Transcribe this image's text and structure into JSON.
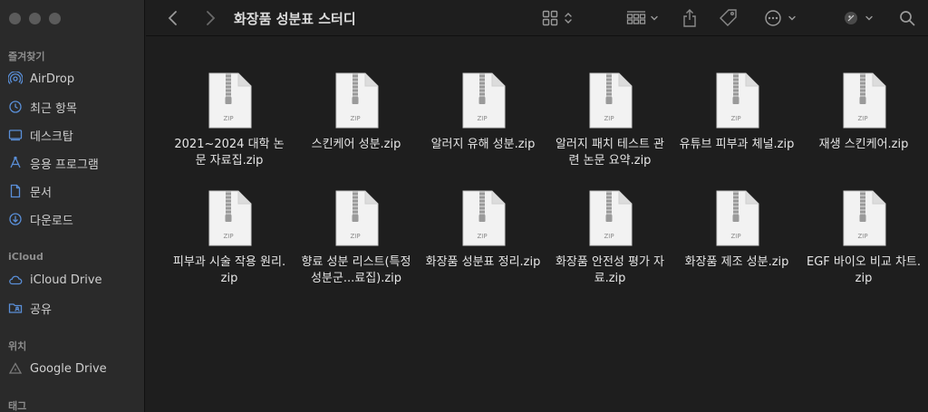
{
  "window": {
    "title": "화장품 성분표 스터디"
  },
  "sidebar": {
    "favorites_title": "즐겨찾기",
    "favorites": [
      {
        "label": "AirDrop",
        "icon": "airdrop-icon"
      },
      {
        "label": "최근 항목",
        "icon": "clock-icon"
      },
      {
        "label": "데스크탑",
        "icon": "desktop-icon"
      },
      {
        "label": "응용 프로그램",
        "icon": "applications-icon"
      },
      {
        "label": "문서",
        "icon": "document-icon"
      },
      {
        "label": "다운로드",
        "icon": "download-icon"
      }
    ],
    "icloud_title": "iCloud",
    "icloud": [
      {
        "label": "iCloud Drive",
        "icon": "cloud-icon"
      },
      {
        "label": "공유",
        "icon": "shared-folder-icon"
      }
    ],
    "locations_title": "위치",
    "locations": [
      {
        "label": "Google Drive",
        "icon": "drive-icon"
      }
    ],
    "tags_title": "태그"
  },
  "files": [
    {
      "name": "2021~2024 대학 논문 자료집.zip",
      "type": "ZIP"
    },
    {
      "name": "스킨케어 성분.zip",
      "type": "ZIP"
    },
    {
      "name": "알러지 유해 성분.zip",
      "type": "ZIP"
    },
    {
      "name": "알러지 패치 테스트 관련 논문 요약.zip",
      "type": "ZIP"
    },
    {
      "name": "유튜브 피부과 체널.zip",
      "type": "ZIP"
    },
    {
      "name": "재생 스킨케어.zip",
      "type": "ZIP"
    },
    {
      "name": "피부과 시술 작용 원리.zip",
      "type": "ZIP"
    },
    {
      "name": "향료 성분 리스트(특정 성분군...료집).zip",
      "type": "ZIP"
    },
    {
      "name": "화장품 성분표 정리.zip",
      "type": "ZIP"
    },
    {
      "name": "화장품 안전성 평가 자료.zip",
      "type": "ZIP"
    },
    {
      "name": "화장품 제조 성분.zip",
      "type": "ZIP"
    },
    {
      "name": "EGF 바이오 비교 차트.zip",
      "type": "ZIP"
    }
  ]
}
